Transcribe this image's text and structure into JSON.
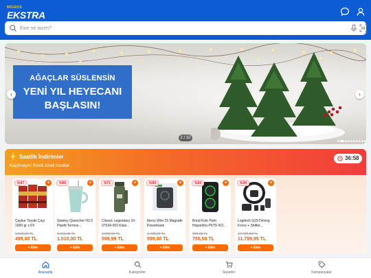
{
  "app": {
    "logo_top": "MİGROS",
    "logo_main": "EKSTRA"
  },
  "header": {
    "icons": [
      "chat-icon",
      "user-icon"
    ]
  },
  "search": {
    "placeholder": "Ewe ne lazım?",
    "icons": [
      "search-icon",
      "microphone-icon",
      "barcode-scan-icon"
    ]
  },
  "banner": {
    "line1": "AĞAÇLAR SÜSLENSİN",
    "line2": "YENİ YIL HEYECANI",
    "line3": "BAŞLASIN!",
    "counter": "2 / 10",
    "dots_total": 10,
    "dots_active": 2
  },
  "deals": {
    "title": "Saatlik İndirimler",
    "subtitle": "Kaçırmayın! Sınırlı süreli fırsatlar",
    "timer": "36:58",
    "add_label": "+ Ekle",
    "accent": "#ff6a00",
    "products": [
      {
        "discount": "%47",
        "name": "Çaykur Tiryaki Çayı 1000 gr x 6'lı",
        "old_price": "1.520,00 TL",
        "new_price": "499,00 TL",
        "icon": "tea-box-icon"
      },
      {
        "discount": "%66",
        "name": "Stanley Quencher H2.0 Pipetli Termos...",
        "old_price": "3.010,00 TL",
        "new_price": "1.010,00 TL",
        "icon": "tumbler-icon"
      },
      {
        "discount": "%71",
        "name": "Classic Legendary 10-07934-003 Klasi...",
        "old_price": "2.099,00 TL",
        "new_price": "599,99 TL",
        "icon": "thermos-icon"
      },
      {
        "discount": "%60",
        "name": "Iberry Wim 25 Magsafe Powerbank",
        "old_price": "1.499,99 TL",
        "new_price": "599,00 TL",
        "icon": "powerbank-icon"
      },
      {
        "discount": "%24",
        "name": "Bood Kule Parti Hoparlörü P575/ KO...",
        "old_price": "999,99 TL",
        "new_price": "755,50 TL",
        "icon": "speaker-icon"
      },
      {
        "discount": "%34",
        "name": "Logitech G29 Driving Force + Shifter...",
        "old_price": "17.799,99 TL",
        "new_price": "11.799,95 TL",
        "icon": "steering-wheel-icon"
      }
    ]
  },
  "bottom_nav": {
    "items": [
      {
        "label": "Anasayfa",
        "icon": "home-icon",
        "active": true
      },
      {
        "label": "Kategoriler",
        "icon": "search-icon",
        "active": false
      },
      {
        "label": "Sepetim",
        "icon": "cart-icon",
        "active": false
      },
      {
        "label": "Kampanyalar",
        "icon": "tag-icon",
        "active": false
      }
    ]
  },
  "colors": {
    "brand_blue": "#0b5cd5",
    "price_orange": "#f35b04",
    "discount_red": "#e3262e"
  }
}
